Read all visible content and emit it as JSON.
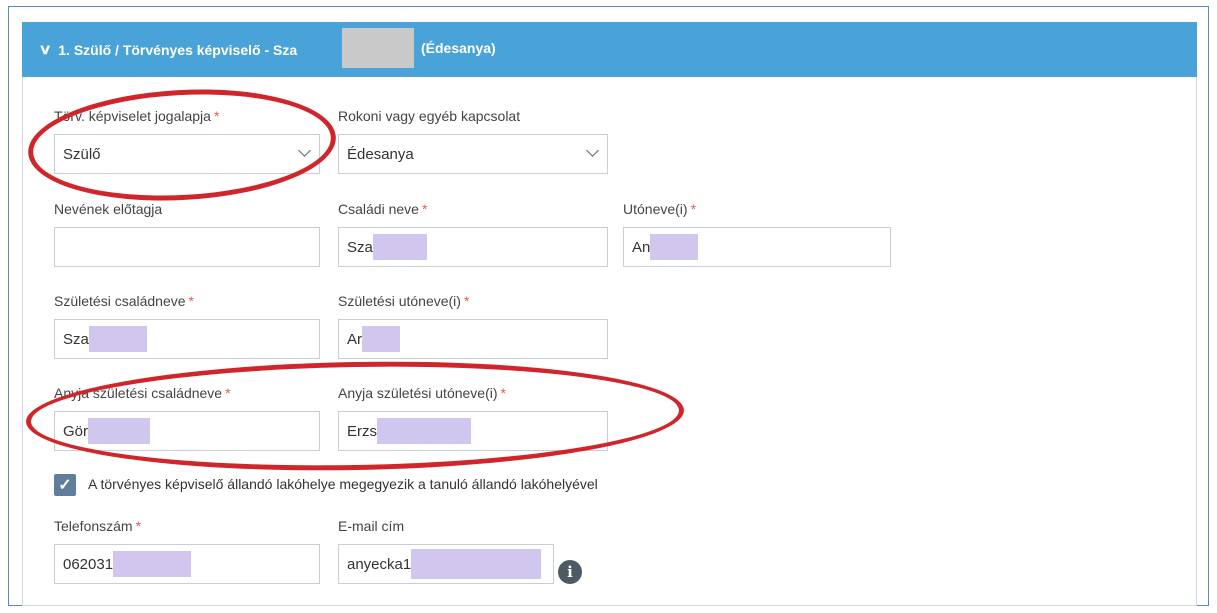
{
  "header": {
    "title_prefix": "1. Szülő / Törvényes képviselő - Sza",
    "title_suffix": "(Édesanya)"
  },
  "fields": {
    "legal_basis": {
      "label": "Törv. képviselet jogalapja",
      "value": "Szülő",
      "required": "*"
    },
    "relationship": {
      "label": "Rokoni vagy egyéb kapcsolat",
      "value": "Édesanya"
    },
    "name_prefix": {
      "label": "Nevének előtagja",
      "value": ""
    },
    "family_name": {
      "label": "Családi neve",
      "value": "Sza",
      "required": "*"
    },
    "given_name": {
      "label": "Utóneve(i)",
      "value": "An",
      "required": "*"
    },
    "birth_family_name": {
      "label": "Születési családneve",
      "value": "Sza",
      "required": "*"
    },
    "birth_given_name": {
      "label": "Születési utóneve(i)",
      "value": "Ar",
      "required": "*"
    },
    "mother_family_name": {
      "label": "Anyja születési családneve",
      "value": "Gör",
      "required": "*"
    },
    "mother_given_name": {
      "label": "Anyja születési utóneve(i)",
      "value": "Erzs",
      "required": "*"
    },
    "phone": {
      "label": "Telefonszám",
      "value": "062031",
      "required": "*"
    },
    "email": {
      "label": "E-mail cím",
      "value": "anyecka1"
    }
  },
  "same_address": {
    "checked": true,
    "label": "A törvényes képviselő állandó lakóhelye megegyezik a tanuló állandó lakóhelyével"
  },
  "colors": {
    "header_bg": "#4aa3d8",
    "annotation_ring": "#d0262b",
    "redaction": "#d0c6ee"
  }
}
